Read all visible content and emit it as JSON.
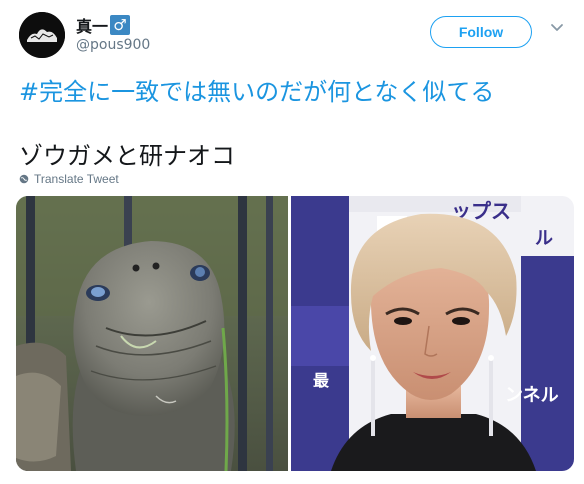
{
  "user": {
    "display_name": "真一",
    "badge": "♂",
    "handle": "@pous900"
  },
  "follow_button": {
    "label": "Follow"
  },
  "tweet": {
    "hashtag_text": "#完全に一致では無いのだが何となく似てる",
    "body_text": "ゾウガメと研ナオコ",
    "translate_label": "Translate Tweet"
  },
  "media": {
    "right_sign_text_1": "ップス",
    "right_sign_text_2": "ル",
    "right_sign_text_3": "ンネル",
    "right_sign_text_4": "最"
  },
  "colors": {
    "accent": "#1da1f2",
    "hashtag": "#1b95e0",
    "muted": "#657786"
  },
  "icons": {
    "chevron": "chevron-down-icon",
    "translate": "globe-icon",
    "badge": "male-sign-icon"
  }
}
